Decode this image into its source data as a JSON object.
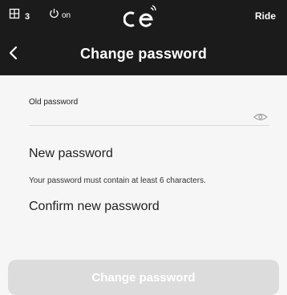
{
  "topbar": {
    "count_text": "3",
    "power_text": "on",
    "ride_label": "Ride",
    "icons": [
      "map-icon",
      "power-icon",
      "brand-logo",
      "back-arrow-icon",
      "eye-icon"
    ]
  },
  "header": {
    "title": "Change password"
  },
  "form": {
    "old_password_label": "Old password",
    "new_password_label": "New password",
    "hint": "Your password must contain at least 6 characters.",
    "confirm_label": "Confirm new password",
    "submit_label": "Change password"
  },
  "colors": {
    "header_bg": "#1b1b1b",
    "page_bg": "#f6f6f6",
    "button_disabled": "#dcdcdc",
    "divider": "#d9d9d9"
  }
}
